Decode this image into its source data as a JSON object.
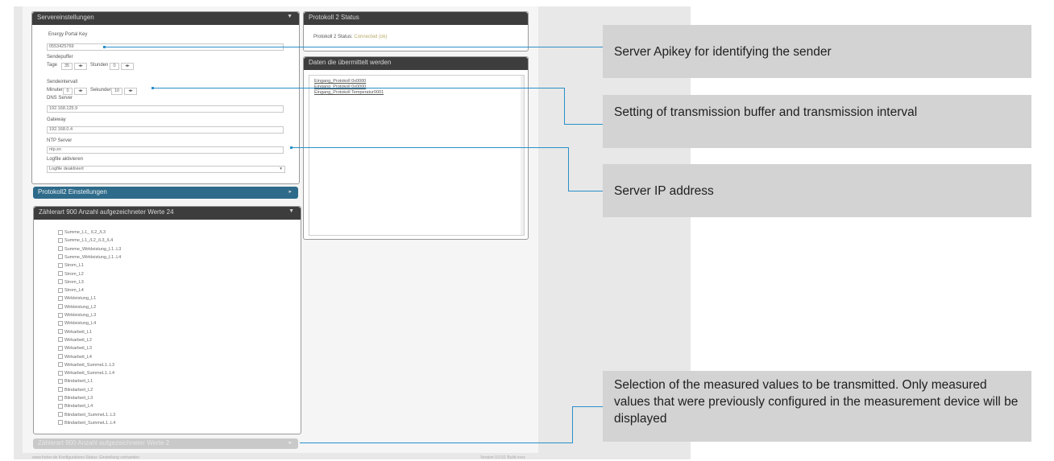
{
  "server_panel": {
    "title": "Servereinstellungen",
    "apikey_label": "Energy Portal Key",
    "apikey_value": "0553425769",
    "buffer_label": "Sendepuffer",
    "days_label": "Tage",
    "days_value": "35",
    "hours_label": "Stunden",
    "hours_value": "0",
    "interval_label": "Sendeintervall",
    "minutes_label": "Minuten",
    "minutes_value": "0",
    "seconds_label": "Sekunden",
    "seconds_value": "10",
    "dns_label": "DNS Server",
    "dns_value": "192.168.125.9",
    "gateway_label": "Gateway",
    "gateway_value": "192.168.0.4",
    "ntp_label": "NTP Server",
    "ntp_value": "ntp.xn",
    "logfile_label": "Logfile aktivieren",
    "logfile_value": "Logfile deaktiviert"
  },
  "protocol2_settings": {
    "title": "Protokoll2 Einstellungen"
  },
  "device_panel": {
    "title": "Zählerart 900 Anzahl aufgezeichneter Werte 24",
    "items": [
      "Summe_L1_ /L2_/L3",
      "Summe_L1_/L2_/L3_/L4",
      "Summe_Wirkleistung_L1..L3",
      "Summe_Wirkleistung_L1..L4",
      "Strom_L1",
      "Strom_L2",
      "Strom_L3",
      "Strom_L4",
      "Wirkleistung_L1",
      "Wirkleistung_L2",
      "Wirkleistung_L3",
      "Wirkleistung_L4",
      "Wirkarbeit_L1",
      "Wirkarbeit_L2",
      "Wirkarbeit_L3",
      "Wirkarbeit_L4",
      "Wirkarbeit_SummeL1..L3",
      "Wirkarbeit_SummeL1..L4",
      "Blindarbeit_L1",
      "Blindarbeit_L2",
      "Blindarbeit_L3",
      "Blindarbeit_L4",
      "Blindarbeit_SummeL1..L3",
      "Blindarbeit_SummeL1..L4"
    ]
  },
  "device_panel_2": {
    "title": "Zählerart 900 Anzahl aufgezeichneter Werte 2"
  },
  "protocol2_status": {
    "title": "Protokoll 2 Status",
    "status_label": "Protokoll 2 Status:",
    "status_value": "Connected (ok)"
  },
  "transmit_panel": {
    "title": "Daten die übermittelt werden",
    "items": [
      "Eingang_Protokoll 0x0000",
      "Eingang_Protokoll 0x0000",
      "Eingang_Protokoll Temperatur0001"
    ]
  },
  "footer": {
    "left": "www.hoher.de Konfigurations-Status: Einstellung vorhanden",
    "right": "Version 0.0.01 Build xxxx"
  },
  "callouts": {
    "apikey": "Server Apikey for identifying the sender",
    "buffer": "Setting of transmission buffer and transmission interval",
    "server_ip": "Server IP address",
    "measured": "Selection of the measured values to be transmitted. Only measured values that were previously configured in the measurement device will be displayed"
  },
  "colors": {
    "leader_line": "#2a8fc9",
    "callout_bg": "#d3d3d3",
    "panel_header": "#3d3d3d",
    "panel_header_blue": "#2e6b8a"
  }
}
